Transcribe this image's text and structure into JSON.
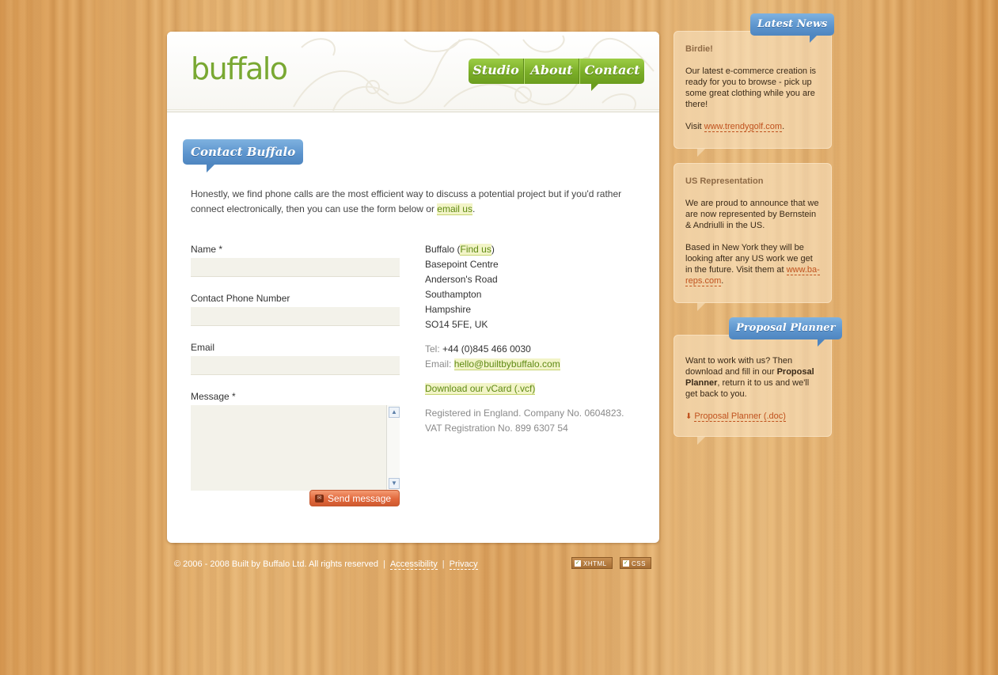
{
  "brand": {
    "logo": "buffalo"
  },
  "nav": {
    "items": [
      {
        "label": "Studio"
      },
      {
        "label": "About"
      },
      {
        "label": "Contact"
      }
    ]
  },
  "page": {
    "title": "Contact Buffalo",
    "intro_before": "Honestly, we find phone calls are the most efficient way to discuss a potential project but if you'd rather connect electronically, then you can use the form below or ",
    "intro_link": "email us",
    "intro_after": "."
  },
  "form": {
    "name_label": "Name *",
    "phone_label": "Contact Phone Number",
    "email_label": "Email",
    "message_label": "Message *",
    "name_value": "",
    "phone_value": "",
    "email_value": "",
    "message_value": "",
    "send_label": "Send message"
  },
  "address": {
    "company_before": "Buffalo (",
    "find_us": "Find us",
    "company_after": ")",
    "line1": "Basepoint Centre",
    "line2": "Anderson's Road",
    "line3": "Southampton",
    "line4": "Hampshire",
    "line5": "SO14 5FE, UK",
    "tel_label": "Tel:",
    "tel_value": "+44 (0)845 466 0030",
    "email_label": "Email:",
    "email_value": "hello@builtbybuffalo.com",
    "vcard": "Download our vCard (.vcf)",
    "reg1": "Registered in England. Company No. 0604823.",
    "reg2": "VAT Registration No. 899 6307 54"
  },
  "footer": {
    "copyright": "© 2006 - 2008 Built by Buffalo Ltd. All rights reserved",
    "accessibility": "Accessibility",
    "privacy": "Privacy",
    "sep": "|",
    "badge_xhtml": "XHTML",
    "badge_css": "CSS"
  },
  "sidebar": {
    "latest_news_tag": "Latest News",
    "news1": {
      "title": "Birdie!",
      "body": "Our latest e-commerce creation is ready for you to browse - pick up some great clothing while you are there!",
      "visit_prefix": "Visit ",
      "link": "www.trendygolf.com",
      "suffix": "."
    },
    "news2": {
      "title": "US Representation",
      "body1": "We are proud to announce that we are now represented by Bernstein & Andriulli in the US.",
      "body2": "Based in New York they will be looking after any US work we get in the future. Visit them at ",
      "link": "www.ba-reps.com",
      "suffix": "."
    },
    "planner_tag": "Proposal Planner",
    "planner": {
      "text1": "Want to work with us? Then download and fill in our ",
      "bold": "Proposal Planner",
      "text2": ", return it to us and we'll get back to you.",
      "link": "Proposal Planner (.doc)"
    }
  },
  "icons": {
    "send": "mail-icon",
    "download": "download-icon",
    "check": "check-icon"
  },
  "colors": {
    "brand_green": "#79a832",
    "accent_blue": "#5b93cc",
    "button_orange": "#e2693d",
    "link_highlight": "#f2f4c7"
  }
}
